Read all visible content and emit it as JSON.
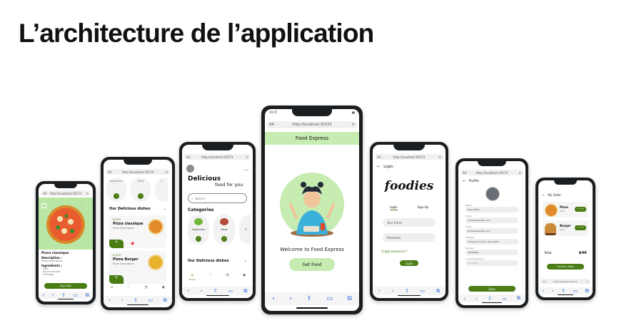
{
  "page": {
    "title": "L’architecture de l’application"
  },
  "phone1": {
    "url": "http://localhost:30174",
    "dish_name": "Pizza classique",
    "description_label": "Description :",
    "description_text": "Pizza Description",
    "ingredients_label": "Ingredients :",
    "ingredients": [
      "Pâte",
      "Sauce tomate",
      "Fromage"
    ],
    "buy_label": "Buy Now"
  },
  "phone2": {
    "url": "http://localhost:30174",
    "categories": [
      "Vegetarien",
      "Meat",
      "Fi"
    ],
    "section_title": "Our Delicious dishes",
    "dishes": [
      {
        "price": "8.00 €",
        "name": "Pizza classique",
        "sub": "Pizza Description"
      },
      {
        "price": "8.00 €",
        "name": "Pizza Burger",
        "sub": "Pizza Description"
      }
    ],
    "nav": [
      "Accueil",
      "",
      "",
      ""
    ]
  },
  "phone3": {
    "url": "http://localhost:30174",
    "headline_1": "Delicious",
    "headline_2": "food for you",
    "search_placeholder": "Search",
    "categories_title": "Categories",
    "categories": [
      "Vegetarien",
      "Meat",
      "Fi"
    ],
    "section_title": "Our Delicious dishes",
    "nav_home": "Home"
  },
  "phone4": {
    "status_time": "19:47",
    "url": "http://localhost:30333",
    "app_title": "Food Express",
    "welcome": "Welcome to Food Express",
    "cta": "Get Food"
  },
  "phone5": {
    "url": "http://localhost:30174",
    "back_label": "Login",
    "brand": "foodies",
    "tab_login": "Login",
    "tab_signup": "Sign-Up",
    "email_placeholder": "Your Email",
    "password_placeholder": "Password",
    "forgot": "Forgot password ?",
    "login_button": "Login"
  },
  "phone6": {
    "url": "http://localhost:30174",
    "header": "Profile",
    "fields": [
      {
        "label": "Name",
        "value": "Molly Pizza"
      },
      {
        "label": "Email",
        "value": "email@example.com"
      },
      {
        "label": "Email",
        "value": "email@example.com"
      },
      {
        "label": "Adresse",
        "value": "19 Rue de la Paix, Tunis 1001"
      },
      {
        "label": "Numero",
        "value": "00000000"
      },
      {
        "label": "Current password",
        "value": "••••••••"
      }
    ],
    "save_button": "Save"
  },
  "phone7": {
    "url": "http://localhost:30174",
    "header": "My Order",
    "items": [
      {
        "name": "Pizza",
        "price": "8.00",
        "qty": "1"
      },
      {
        "name": "Burger",
        "price": "8.00",
        "qty": "1"
      }
    ],
    "total_label": "Total",
    "total_value": "$46",
    "confirm": "Confirm order"
  },
  "colors": {
    "accent_green": "#4a7d14",
    "light_green": "#c6ecb2",
    "phone_frame": "#1b1e21"
  }
}
